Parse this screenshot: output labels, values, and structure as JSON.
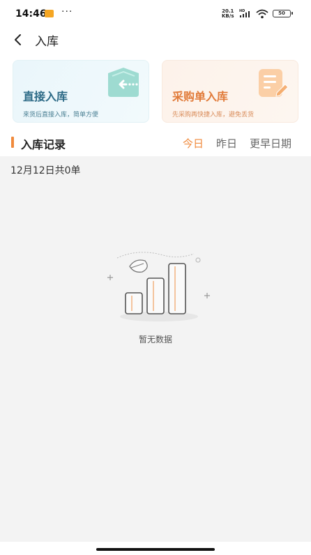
{
  "status_bar": {
    "time": "14:46",
    "more": "···",
    "net_speed_value": "20.1",
    "net_speed_unit": "KB/s",
    "hd_label": "HD",
    "battery": "50"
  },
  "nav": {
    "title": "入库",
    "back_icon": "chevron-left-icon"
  },
  "cards": [
    {
      "title": "直接入库",
      "subtitle": "来货后直接入库，简单方便",
      "icon": "inbound-arrow-icon",
      "accent": "#2c6a86"
    },
    {
      "title": "采购单入库",
      "subtitle": "先采购再快捷入库，避免丢货",
      "icon": "document-edit-icon",
      "accent": "#e17b3a"
    }
  ],
  "records": {
    "section_title": "入库记录",
    "tabs": [
      {
        "label": "今日",
        "active": true
      },
      {
        "label": "昨日",
        "active": false
      },
      {
        "label": "更早日期",
        "active": false
      }
    ],
    "summary": "12月12日共0单",
    "empty_text": "暂无数据"
  },
  "colors": {
    "accent_orange": "#f08a3c",
    "background_gray": "#f3f3f3"
  }
}
